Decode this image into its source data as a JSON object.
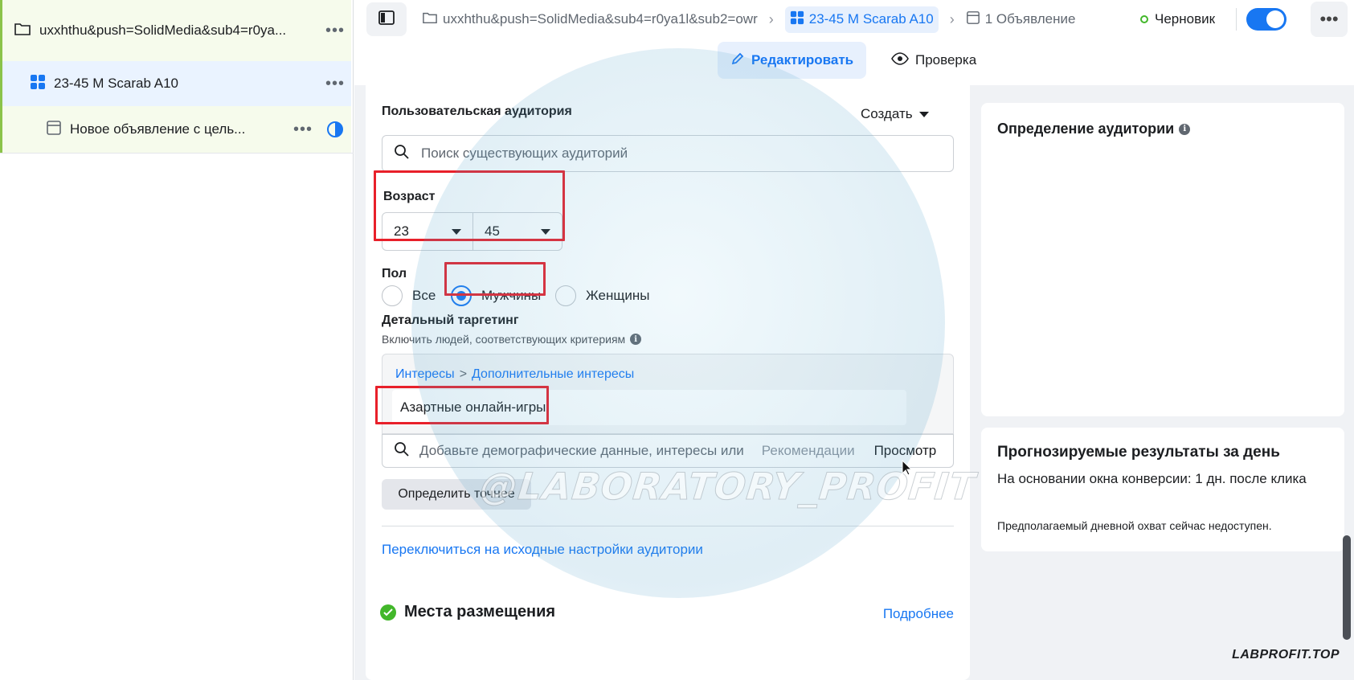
{
  "tree": {
    "campaign": "uxxhthu&push=SolidMedia&sub4=r0ya...",
    "adset": "23-45 M Scarab A10",
    "ad": "Новое объявление с цель..."
  },
  "topbar": {
    "crumb_campaign": "uxxhthu&push=SolidMedia&sub4=r0ya1l&sub2=owr",
    "crumb_adset": "23-45 M Scarab A10",
    "crumb_ad": "1 Объявление",
    "status": "Черновик"
  },
  "modes": {
    "edit": "Редактировать",
    "review": "Проверка"
  },
  "audience": {
    "custom_title": "Пользовательская аудитория",
    "create_label": "Создать",
    "search_placeholder": "Поиск существующих аудиторий",
    "age_label": "Возраст",
    "age_min": "23",
    "age_max": "45",
    "gender_label": "Пол",
    "gender_all": "Все",
    "gender_men": "Мужчины",
    "gender_women": "Женщины",
    "detailed_title": "Детальный таргетинг",
    "detailed_sub": "Включить людей, соответствующих критериям",
    "path_interests": "Интересы",
    "path_sep": ">",
    "path_more": "Дополнительные интересы",
    "interest_item": "Азартные онлайн-игры",
    "dt_search_placeholder": "Добавьте демографические данные, интересы или",
    "dt_recommend": "Рекомендации",
    "dt_view": "Просмотр",
    "refine": "Определить точнее",
    "switch_link": "Переключиться на исходные настройки аудитории"
  },
  "placements": {
    "title": "Места размещения",
    "more": "Подробнее"
  },
  "right": {
    "aud_def_title": "Определение аудитории",
    "est_title": "Прогнозируемые результаты за день",
    "est_sub": "На основании окна конверсии: 1 дн. после клика",
    "est_note": "Предполагаемый дневной охват сейчас недоступен."
  },
  "overlay": {
    "watermark": "@LABORATORY_PROFIT",
    "brand": "LABPROFIT.TOP"
  },
  "colors": {
    "accent": "#1877f2",
    "highlight": "#e8202a",
    "success": "#42b72a"
  }
}
